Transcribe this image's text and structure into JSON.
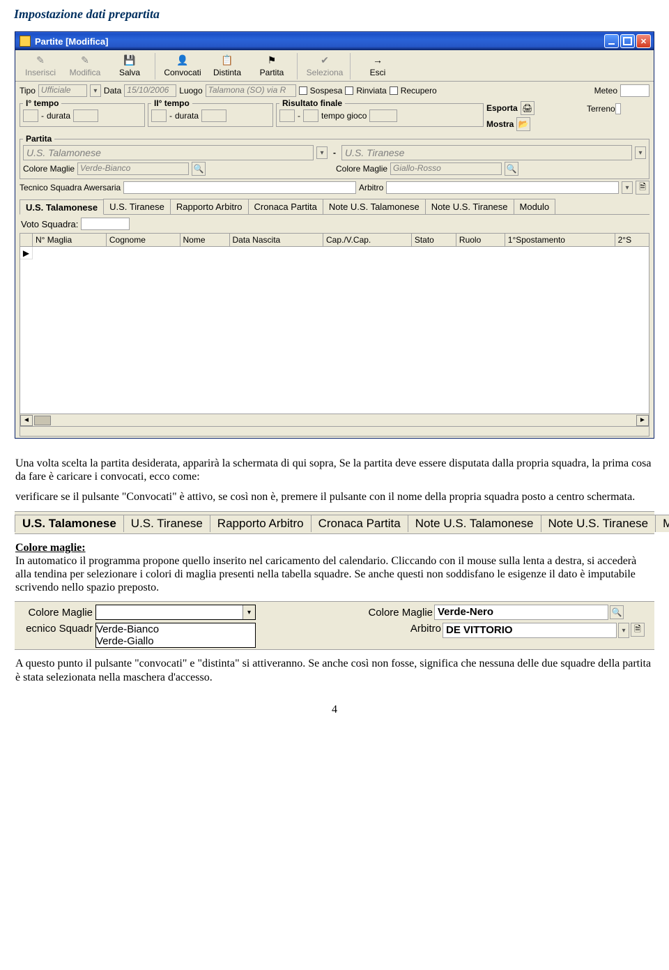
{
  "pageTitle": "Impostazione dati prepartita",
  "window": {
    "title": "Partite [Modifica]",
    "toolbar": [
      {
        "label": "Inserisci",
        "glyph": "✎",
        "disabled": true
      },
      {
        "label": "Modifica",
        "glyph": "✎",
        "disabled": true
      },
      {
        "label": "Salva",
        "glyph": "💾",
        "disabled": false
      },
      {
        "sep": true
      },
      {
        "label": "Convocati",
        "glyph": "👤",
        "disabled": false
      },
      {
        "label": "Distinta",
        "glyph": "📋",
        "disabled": false
      },
      {
        "label": "Partita",
        "glyph": "⚑",
        "disabled": false
      },
      {
        "sep": true
      },
      {
        "label": "Seleziona",
        "glyph": "✔",
        "disabled": true
      },
      {
        "sep": true
      },
      {
        "label": "Esci",
        "glyph": "→",
        "disabled": false
      }
    ],
    "row1": {
      "tipoLabel": "Tipo",
      "tipoValue": "Ufficiale",
      "dataLabel": "Data",
      "dataValue": "15/10/2006",
      "luogoLabel": "Luogo",
      "luogoValue": "Talamona (SO) via R",
      "sospesa": "Sospesa",
      "rinviata": "Rinviata",
      "recupero": "Recupero",
      "meteoLabel": "Meteo"
    },
    "row2": {
      "tempo1": "I° tempo",
      "tempo2": "II° tempo",
      "durata": "durata",
      "risultato": "Risultato finale",
      "tempoGioco": "tempo gioco",
      "esporta": "Esporta",
      "mostra": "Mostra",
      "terreno": "Terreno"
    },
    "partita": {
      "legend": "Partita",
      "home": "U.S. Talamonese",
      "away": "U.S. Tiranese",
      "cmLabel": "Colore Maglie",
      "cmHome": "Verde-Bianco",
      "cmAway": "Giallo-Rosso",
      "tecnico": "Tecnico Squadra Awersaria",
      "arbitro": "Arbitro"
    },
    "tabs": [
      "U.S. Talamonese",
      "U.S. Tiranese",
      "Rapporto Arbitro",
      "Cronaca Partita",
      "Note U.S. Talamonese",
      "Note U.S. Tiranese",
      "Modulo"
    ],
    "votoLabel": "Voto Squadra:",
    "columns": [
      "N° Maglia",
      "Cognome",
      "Nome",
      "Data Nascita",
      "Cap./V.Cap.",
      "Stato",
      "Ruolo",
      "1°Spostamento",
      "2°S"
    ]
  },
  "para1": "Una volta scelta la partita desiderata, apparirà la schermata di qui sopra, Se la partita deve essere disputata dalla propria squadra, la prima cosa da fare è caricare i convocati, ecco come:",
  "para2": "verificare se il pulsante \"Convocati\" è attivo, se così non è, premere il pulsante con il nome della propria squadra posto a centro schermata.",
  "sliceTabs": [
    "U.S. Talamonese",
    "U.S. Tiranese",
    "Rapporto Arbitro",
    "Cronaca Partita",
    "Note U.S. Talamonese",
    "Note U.S. Tiranese",
    "Modulo"
  ],
  "subHead": "Colore maglie:",
  "para3": "In automatico il programma propone quello inserito nel caricamento del calendario. Cliccando con il mouse sulla lenta a destra, si accederà alla tendina per selezionare i colori di maglia presenti nella tabella squadre. Se anche questi non soddisfano le esigenze il dato è imputabile scrivendo nello spazio preposto.",
  "slice2": {
    "cmLeftLabel": "Colore Maglie",
    "cmRightLabel": "Colore Maglie",
    "cmRightValue": "Verde-Nero",
    "tecnico": "ecnico Squadr",
    "arbitroLabel": "Arbitro",
    "arbitroValue": "DE VITTORIO",
    "options": [
      "Verde-Bianco",
      "Verde-Giallo"
    ]
  },
  "para4": "A questo punto il pulsante \"convocati\" e \"distinta\" si attiveranno. Se anche così non fosse, significa che nessuna delle due squadre della partita è stata selezionata nella maschera d'accesso.",
  "pageNum": "4"
}
